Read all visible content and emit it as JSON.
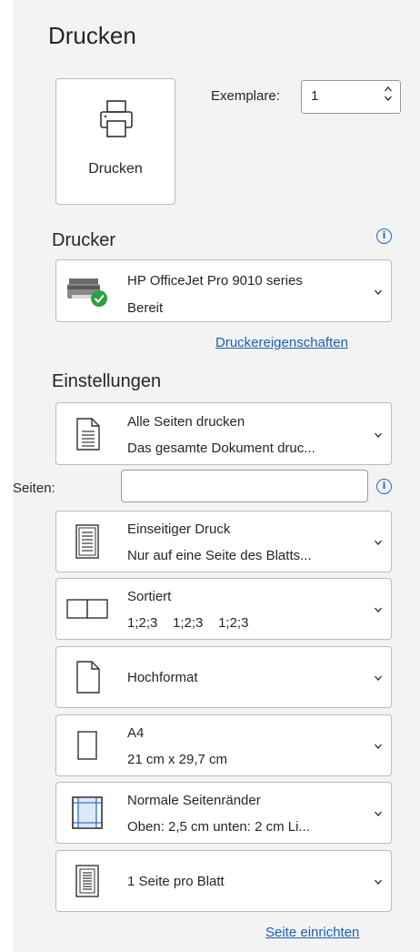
{
  "header": {
    "title": "Drucken"
  },
  "print_button": {
    "label": "Drucken",
    "icon": "printer-icon"
  },
  "copies": {
    "label": "Exemplare:",
    "value": "1"
  },
  "printer_section": {
    "title": "Drucker",
    "info_icon": "i",
    "printer": {
      "name": "HP OfficeJet Pro 9010 series",
      "status": "Bereit",
      "icon": "printer-ready-icon"
    },
    "properties_link": "Druckereigenschaften"
  },
  "settings_section": {
    "title": "Einstellungen",
    "pages_label": "Seiten:",
    "pages_value": "",
    "info_icon": "i",
    "dropdowns": [
      {
        "line1": "Alle Seiten drucken",
        "line2": "Das gesamte Dokument druc...",
        "icon": "all-pages-icon"
      },
      {
        "line1": "Einseitiger Druck",
        "line2": "Nur auf eine Seite des Blatts...",
        "icon": "one-sided-icon"
      },
      {
        "line1": "Sortiert",
        "line2": "1;2;3    1;2;3    1;2;3",
        "icon": "collated-icon"
      },
      {
        "line1": "Hochformat",
        "line2": "",
        "icon": "portrait-icon"
      },
      {
        "line1": "A4",
        "line2": "21 cm x 29,7 cm",
        "icon": "paper-size-icon"
      },
      {
        "line1": "Normale Seitenränder",
        "line2": "Oben: 2,5 cm unten: 2 cm Li...",
        "icon": "margins-icon"
      },
      {
        "line1": "1 Seite pro Blatt",
        "line2": "",
        "icon": "pages-per-sheet-icon"
      }
    ],
    "page_setup_link": "Seite einrichten"
  },
  "colors": {
    "link": "#1a5fb4",
    "info": "#2168c9",
    "panel_bg": "#f3f3f3",
    "ready_green": "#2ea043"
  }
}
